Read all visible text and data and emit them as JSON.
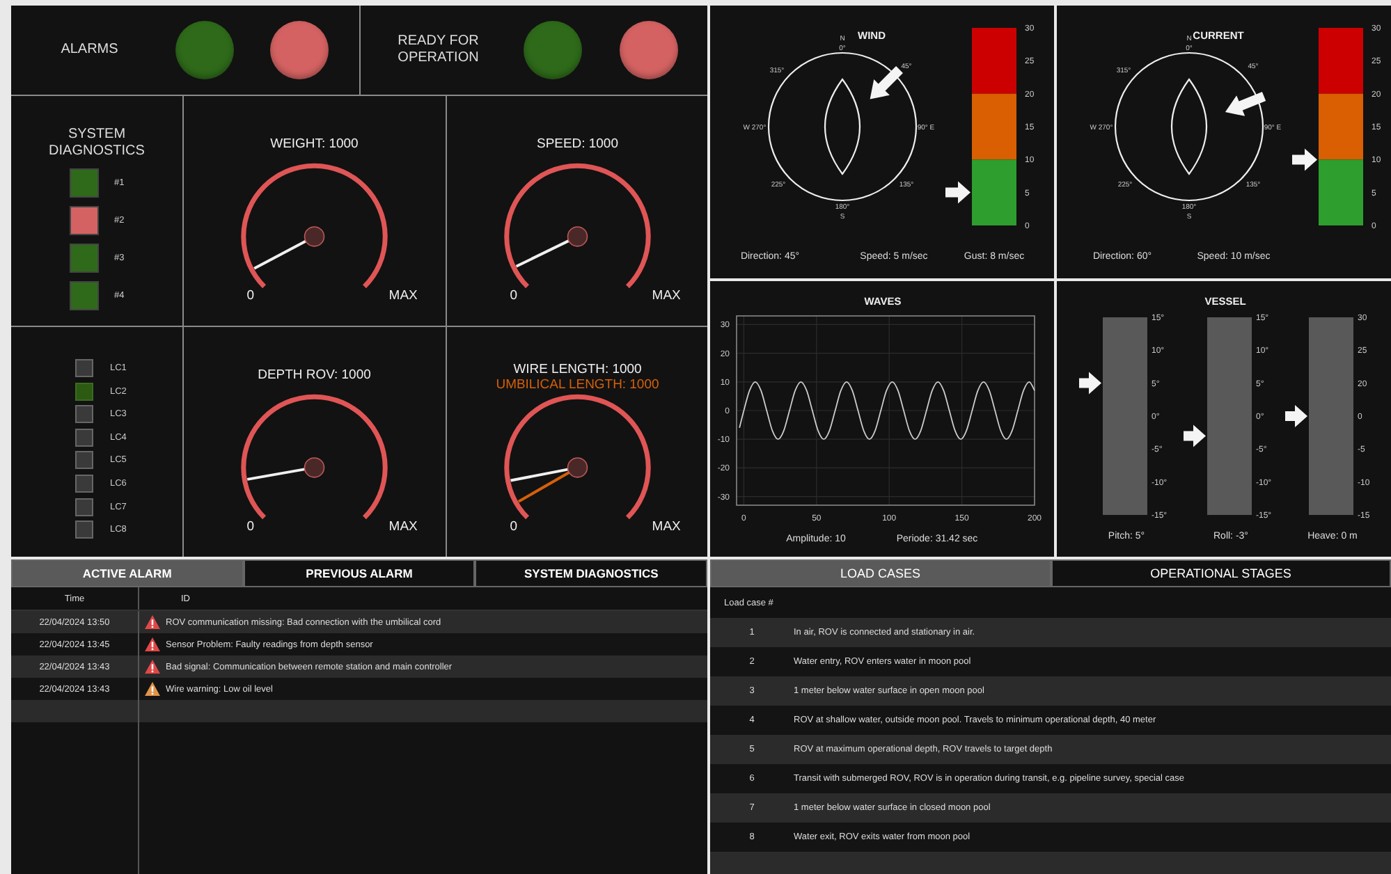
{
  "status_lamps": [
    {
      "label": "ALARMS",
      "lamps": [
        {
          "color": "#2e6a1a"
        },
        {
          "color": "#d46262"
        }
      ]
    },
    {
      "label": "READY FOR OPERATION",
      "lamps": [
        {
          "color": "#2e6a1a"
        },
        {
          "color": "#d46262"
        }
      ]
    }
  ],
  "system_diagnostics": {
    "title": "SYSTEM DIAGNOSTICS",
    "items": [
      {
        "label": "#1",
        "color": "#2e6a1a"
      },
      {
        "label": "#2",
        "color": "#d46262"
      },
      {
        "label": "#3",
        "color": "#2e6a1a"
      },
      {
        "label": "#4",
        "color": "#2e6a1a"
      }
    ]
  },
  "load_case_indicators": [
    {
      "label": "LC1",
      "on": false
    },
    {
      "label": "LC2",
      "on": true
    },
    {
      "label": "LC3",
      "on": false
    },
    {
      "label": "LC4",
      "on": false
    },
    {
      "label": "LC5",
      "on": false
    },
    {
      "label": "LC6",
      "on": false
    },
    {
      "label": "LC7",
      "on": false
    },
    {
      "label": "LC8",
      "on": false
    }
  ],
  "gauges": [
    {
      "title": "WEIGHT: 1000",
      "min_label": "0",
      "max_label": "MAX",
      "needles": [
        {
          "kind": "wire"
        }
      ]
    },
    {
      "title": "SPEED: 1000",
      "min_label": "0",
      "max_label": "MAX",
      "needles": [
        {
          "kind": "wire"
        }
      ]
    },
    {
      "title": "DEPTH ROV: 1000",
      "min_label": "0",
      "max_label": "MAX",
      "needles": [
        {
          "kind": "wire"
        }
      ]
    },
    {
      "title": "WIRE LENGTH: 1000",
      "subtitle": "UMBILICAL LENGTH: 1000",
      "min_label": "0",
      "max_label": "MAX",
      "needles": [
        {
          "kind": "wire"
        },
        {
          "kind": "umbilical"
        }
      ]
    }
  ],
  "wind": {
    "title": "WIND",
    "compass": {
      "labels": [
        "N",
        "0°",
        "45°",
        "90° E",
        "135°",
        "180°",
        "S",
        "225°",
        "W 270°",
        "315°"
      ]
    },
    "scale": {
      "ticks": [
        "30",
        "25",
        "20",
        "15",
        "10",
        "5",
        "0"
      ],
      "segments": [
        {
          "color": "#cc0000"
        },
        {
          "color": "#d95f02"
        },
        {
          "color": "#2e9e2e"
        }
      ]
    },
    "readings": [
      "Direction: 45°",
      "Speed: 5 m/sec",
      "Gust: 8 m/sec"
    ]
  },
  "current": {
    "title": "CURRENT",
    "compass": {
      "labels": [
        "N",
        "0°",
        "45°",
        "90° E",
        "135°",
        "180°",
        "S",
        "225°",
        "W 270°",
        "315°"
      ]
    },
    "scale": {
      "ticks": [
        "30",
        "25",
        "20",
        "15",
        "10",
        "5",
        "0"
      ],
      "segments": [
        {
          "color": "#cc0000"
        },
        {
          "color": "#d95f02"
        },
        {
          "color": "#2e9e2e"
        }
      ]
    },
    "readings": [
      "Direction: 60°",
      "Speed: 10 m/sec"
    ]
  },
  "waves": {
    "chart_data": {
      "type": "line",
      "title": "WAVES",
      "grid": true,
      "xlim": [
        -5,
        200
      ],
      "ylim": [
        -33,
        33
      ],
      "xticks": [
        0,
        50,
        100,
        150,
        200
      ],
      "yticks": [
        30,
        20,
        10,
        0,
        -10,
        -20,
        -30
      ],
      "x": [
        -3,
        0,
        3.93,
        7.85,
        11.78,
        15.71,
        19.63,
        23.56,
        27.49,
        31.42,
        35.34,
        39.27,
        43.2,
        47.12,
        51.05,
        54.98,
        58.9,
        62.83,
        66.76,
        70.69,
        74.61,
        78.54,
        82.47,
        86.39,
        90.32,
        94.25,
        98.17,
        102.1,
        106.03,
        109.96,
        113.88,
        117.81,
        121.74,
        125.66,
        129.59,
        133.52,
        137.44,
        141.37,
        145.3,
        149.23,
        153.15,
        157.08,
        161.01,
        164.93,
        168.86,
        172.79,
        176.71,
        180.64,
        184.57,
        188.5,
        192.42,
        196.35,
        200
      ],
      "series": [
        {
          "color": "#cccccc",
          "values": [
            -6,
            0,
            7,
            10,
            7,
            0,
            -7,
            -10,
            -7,
            0,
            7,
            10,
            7,
            0,
            -7,
            -10,
            -7,
            0,
            7,
            10,
            7,
            0,
            -7,
            -10,
            -7,
            0,
            7,
            10,
            7,
            0,
            -7,
            -10,
            -7,
            0,
            7,
            10,
            7,
            0,
            -7,
            -10,
            -7,
            0,
            7,
            10,
            7,
            0,
            -7,
            -10,
            -7,
            0,
            7,
            10,
            7
          ]
        }
      ]
    },
    "readings": [
      "Amplitude: 10",
      "Periode: 31.42 sec"
    ]
  },
  "vessel": {
    "title": "VESSEL",
    "indicators": [
      {
        "ticks": [
          "15°",
          "10°",
          "5°",
          "0°",
          "-5°",
          "-10°",
          "-15°"
        ],
        "reading": "Pitch: 5°"
      },
      {
        "ticks": [
          "15°",
          "10°",
          "5°",
          "0°",
          "-5°",
          "-10°",
          "-15°"
        ],
        "reading": "Roll: -3°"
      },
      {
        "ticks": [
          "30",
          "25",
          "20",
          "0",
          "-5",
          "-10",
          "-15"
        ],
        "reading": "Heave: 0 m"
      }
    ]
  },
  "alarm_tabs": [
    {
      "label": "ACTIVE ALARM",
      "selected": true
    },
    {
      "label": "PREVIOUS ALARM",
      "selected": false
    },
    {
      "label": "SYSTEM DIAGNOSTICS",
      "selected": false
    }
  ],
  "alarm_table": {
    "columns": [
      "Time",
      "ID"
    ],
    "rows": [
      {
        "time": "22/04/2024 13:50",
        "kind": "alarm",
        "message": "ROV communication missing: Bad connection with the umbilical cord"
      },
      {
        "time": "22/04/2024 13:45",
        "kind": "alarm",
        "message": "Sensor Problem: Faulty readings from depth sensor"
      },
      {
        "time": "22/04/2024 13:43",
        "kind": "alarm",
        "message": "Bad signal: Communication between remote station and main controller"
      },
      {
        "time": "22/04/2024 13:43",
        "kind": "warning",
        "message": "Wire warning: Low oil level"
      }
    ]
  },
  "load_tabs": [
    {
      "label": "LOAD CASES",
      "selected": true
    },
    {
      "label": "OPERATIONAL STAGES",
      "selected": false
    }
  ],
  "load_table": {
    "columns": [
      "Load case #"
    ],
    "rows": [
      {
        "number": "1",
        "description": "In air, ROV is connected and stationary in air."
      },
      {
        "number": "2",
        "description": "Water entry, ROV enters water in moon pool"
      },
      {
        "number": "3",
        "description": "1 meter below water surface in open moon pool"
      },
      {
        "number": "4",
        "description": "ROV at shallow water, outside moon pool. Travels to minimum operational depth, 40 meter"
      },
      {
        "number": "5",
        "description": "ROV at maximum operational depth, ROV travels to target depth"
      },
      {
        "number": "6",
        "description": "Transit with submerged ROV, ROV is in operation during transit, e.g. pipeline survey, special case"
      },
      {
        "number": "7",
        "description": "1 meter below water surface in closed moon pool"
      },
      {
        "number": "8",
        "description": "Water exit, ROV exits water from moon pool"
      }
    ]
  }
}
